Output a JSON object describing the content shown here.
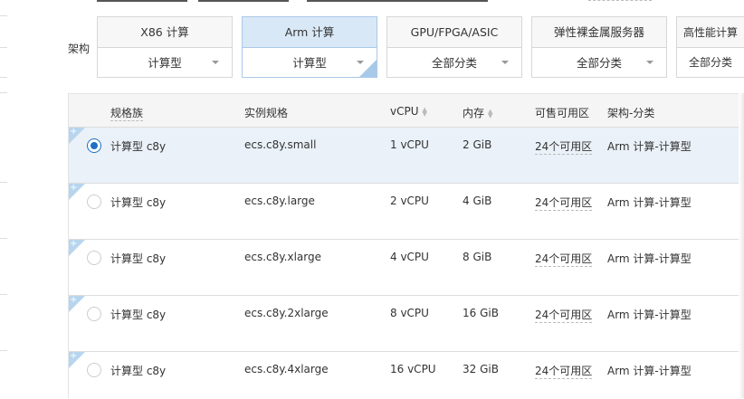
{
  "filter": {
    "arch_label": "架构",
    "cards": [
      {
        "title": "X86 计算",
        "selected": "计算型",
        "active": false
      },
      {
        "title": "Arm 计算",
        "selected": "计算型",
        "active": true
      },
      {
        "title": "GPU/FPGA/ASIC",
        "selected": "全部分类",
        "active": false
      },
      {
        "title": "弹性裸金属服务器",
        "selected": "全部分类",
        "active": false
      },
      {
        "title": "高性能计算",
        "selected": "全部分类",
        "active": false
      }
    ]
  },
  "table": {
    "headers": {
      "family": "规格族",
      "spec": "实例规格",
      "vcpu": "vCPU",
      "memory": "内存",
      "zones": "可售可用区",
      "arch": "架构-分类"
    },
    "rows": [
      {
        "family": "计算型 c8y",
        "spec": "ecs.c8y.small",
        "vcpu": "1 vCPU",
        "memory": "2 GiB",
        "zones": "24个可用区",
        "arch": "Arm 计算-计算型",
        "selected": true
      },
      {
        "family": "计算型 c8y",
        "spec": "ecs.c8y.large",
        "vcpu": "2 vCPU",
        "memory": "4 GiB",
        "zones": "24个可用区",
        "arch": "Arm 计算-计算型",
        "selected": false
      },
      {
        "family": "计算型 c8y",
        "spec": "ecs.c8y.xlarge",
        "vcpu": "4 vCPU",
        "memory": "8 GiB",
        "zones": "24个可用区",
        "arch": "Arm 计算-计算型",
        "selected": false
      },
      {
        "family": "计算型 c8y",
        "spec": "ecs.c8y.2xlarge",
        "vcpu": "8 vCPU",
        "memory": "16 GiB",
        "zones": "24个可用区",
        "arch": "Arm 计算-计算型",
        "selected": false
      },
      {
        "family": "计算型 c8y",
        "spec": "ecs.c8y.4xlarge",
        "vcpu": "16 vCPU",
        "memory": "32 GiB",
        "zones": "24个可用区",
        "arch": "Arm 计算-计算型",
        "selected": false
      }
    ]
  }
}
